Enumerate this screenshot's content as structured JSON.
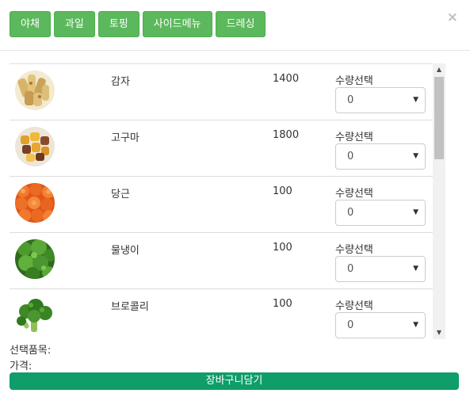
{
  "tabs": [
    "야채",
    "과일",
    "토핑",
    "사이드메뉴",
    "드레싱"
  ],
  "close_icon": "×",
  "qty_label": "수량선택",
  "items": [
    {
      "name": "감자",
      "price": "1400",
      "qty": "0",
      "image": "potato-image"
    },
    {
      "name": "고구마",
      "price": "1800",
      "qty": "0",
      "image": "sweet-potato-image"
    },
    {
      "name": "당근",
      "price": "100",
      "qty": "0",
      "image": "carrot-image"
    },
    {
      "name": "물냉이",
      "price": "100",
      "qty": "0",
      "image": "watercress-image"
    },
    {
      "name": "브로콜리",
      "price": "100",
      "qty": "0",
      "image": "broccoli-image"
    }
  ],
  "footer": {
    "selected_label": "선택품목:",
    "price_label": "가격:",
    "cart_button": "장바구니담기"
  },
  "colors": {
    "tab_green": "#5cb85c",
    "cart_green": "#0f9d6a"
  }
}
